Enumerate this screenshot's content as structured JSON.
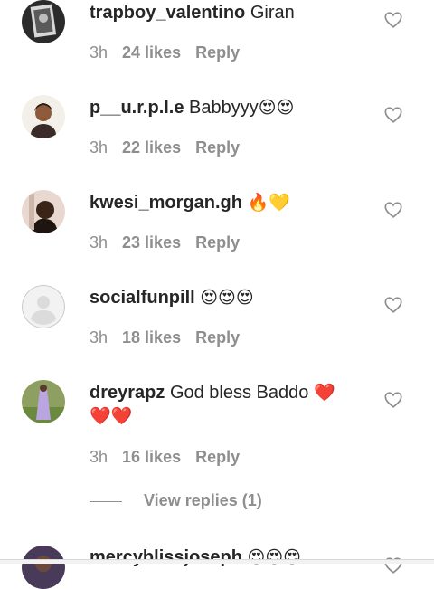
{
  "comments": [
    {
      "username": "trapboy_valentino",
      "text": "Giran",
      "emoji": "",
      "emoji2": "",
      "time": "3h",
      "likes": "24 likes",
      "reply": "Reply"
    },
    {
      "username": "p__u.r.p.l.e",
      "text": "Babbyyy",
      "emoji": "😍😍",
      "emoji2": "",
      "time": "3h",
      "likes": "22 likes",
      "reply": "Reply"
    },
    {
      "username": "kwesi_morgan.gh",
      "text": "",
      "emoji": "🔥💛",
      "emoji2": "",
      "time": "3h",
      "likes": "23 likes",
      "reply": "Reply"
    },
    {
      "username": "socialfunpill",
      "text": "",
      "emoji": "😍😍😍",
      "emoji2": "",
      "time": "3h",
      "likes": "18 likes",
      "reply": "Reply"
    },
    {
      "username": "dreyrapz",
      "text": "God bless Baddo",
      "emoji": "❤️",
      "emoji2": "❤️❤️",
      "time": "3h",
      "likes": "16 likes",
      "reply": "Reply"
    },
    {
      "username": "mercyblissjoseph",
      "text": "",
      "emoji": "😍😍😍",
      "emoji2": "",
      "time": "",
      "likes": "",
      "reply": ""
    }
  ],
  "view_replies": "View replies (1)",
  "icons": {
    "like": "heart-outline-icon"
  },
  "colors": {
    "text": "#262626",
    "muted": "#8e8e8e",
    "heart_stroke": "#8e8e8e",
    "fire": "#f57c00",
    "yellow_heart": "#fbc02d",
    "red_heart": "#e53935"
  }
}
